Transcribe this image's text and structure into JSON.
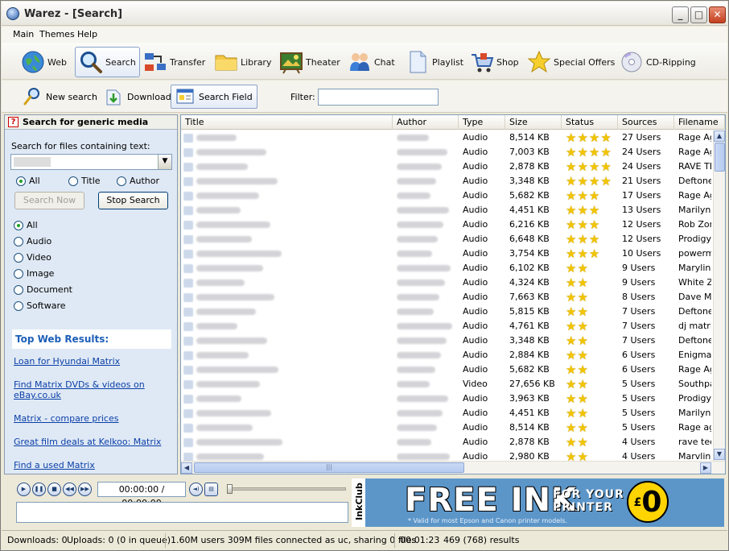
{
  "window": {
    "title": "Warez - [Search]"
  },
  "menu": [
    "Main",
    "Themes",
    "Help"
  ],
  "toolbar": [
    {
      "label": "Web",
      "icon": "globe-icon"
    },
    {
      "label": "Search",
      "icon": "magnifier-icon",
      "active": true
    },
    {
      "label": "Transfer",
      "icon": "transfer-icon"
    },
    {
      "label": "Library",
      "icon": "folder-icon"
    },
    {
      "label": "Theater",
      "icon": "theater-icon"
    },
    {
      "label": "Chat",
      "icon": "chat-people-icon"
    },
    {
      "label": "Playlist",
      "icon": "document-icon"
    },
    {
      "label": "Shop",
      "icon": "cart-icon"
    },
    {
      "label": "Special Offers",
      "icon": "star-icon"
    },
    {
      "label": "CD-Ripping",
      "icon": "cd-icon"
    }
  ],
  "toolbar2": {
    "new_search": "New search",
    "download": "Download",
    "search_field": "Search Field",
    "filter_label": "Filter:",
    "filter_value": ""
  },
  "left": {
    "header": "Search for generic media",
    "search_label": "Search for files containing text:",
    "scope": [
      "All",
      "Title",
      "Author"
    ],
    "search_now": "Search Now",
    "stop_search": "Stop Search",
    "types": [
      "All",
      "Audio",
      "Video",
      "Image",
      "Document",
      "Software"
    ],
    "top_web": "Top Web Results:",
    "links": [
      "Loan for Hyundai Matrix",
      "Find Matrix DVDs & videos on eBay.co.uk",
      "Matrix - compare prices",
      "Great film deals at Kelkoo: Matrix",
      "Find a used Matrix"
    ]
  },
  "table": {
    "columns": [
      "Title",
      "Author",
      "Type",
      "Size",
      "Status",
      "Sources",
      "Filename"
    ],
    "rows": [
      {
        "type": "Audio",
        "size": "8,514 KB",
        "stars": 4,
        "sources": "27 Users",
        "file": "Rage Ag"
      },
      {
        "type": "Audio",
        "size": "7,003 KB",
        "stars": 4,
        "sources": "24 Users",
        "file": "Rage Ag"
      },
      {
        "type": "Audio",
        "size": "2,878 KB",
        "stars": 4,
        "sources": "24 Users",
        "file": "RAVE TE"
      },
      {
        "type": "Audio",
        "size": "3,348 KB",
        "stars": 4,
        "sources": "21 Users",
        "file": "Deftone"
      },
      {
        "type": "Audio",
        "size": "5,682 KB",
        "stars": 3,
        "sources": "17 Users",
        "file": "Rage Ag"
      },
      {
        "type": "Audio",
        "size": "4,451 KB",
        "stars": 3,
        "sources": "13 Users",
        "file": "Marilyn M"
      },
      {
        "type": "Audio",
        "size": "6,216 KB",
        "stars": 3,
        "sources": "12 Users",
        "file": "Rob Zom"
      },
      {
        "type": "Audio",
        "size": "6,648 KB",
        "stars": 3,
        "sources": "12 Users",
        "file": "Prodigy -"
      },
      {
        "type": "Audio",
        "size": "3,754 KB",
        "stars": 3,
        "sources": "10 Users",
        "file": "powerma"
      },
      {
        "type": "Audio",
        "size": "6,102 KB",
        "stars": 2,
        "sources": "9 Users",
        "file": "Marylin M"
      },
      {
        "type": "Audio",
        "size": "4,324 KB",
        "stars": 2,
        "sources": "9 Users",
        "file": "White Zo"
      },
      {
        "type": "Audio",
        "size": "7,663 KB",
        "stars": 2,
        "sources": "8 Users",
        "file": "Dave Ma"
      },
      {
        "type": "Audio",
        "size": "5,815 KB",
        "stars": 2,
        "sources": "7 Users",
        "file": "Deftones"
      },
      {
        "type": "Audio",
        "size": "4,761 KB",
        "stars": 2,
        "sources": "7 Users",
        "file": "dj matrix"
      },
      {
        "type": "Audio",
        "size": "3,348 KB",
        "stars": 2,
        "sources": "7 Users",
        "file": "Deftones"
      },
      {
        "type": "Audio",
        "size": "2,884 KB",
        "stars": 2,
        "sources": "6 Users",
        "file": "Enigma -"
      },
      {
        "type": "Audio",
        "size": "5,682 KB",
        "stars": 2,
        "sources": "6 Users",
        "file": "Rage Ag"
      },
      {
        "type": "Video",
        "size": "27,656 KB",
        "stars": 2,
        "sources": "5 Users",
        "file": "Southpa"
      },
      {
        "type": "Audio",
        "size": "3,963 KB",
        "stars": 2,
        "sources": "5 Users",
        "file": "Prodigy -"
      },
      {
        "type": "Audio",
        "size": "4,451 KB",
        "stars": 2,
        "sources": "5 Users",
        "file": "Marilyn M"
      },
      {
        "type": "Audio",
        "size": "8,514 KB",
        "stars": 2,
        "sources": "5 Users",
        "file": "Rage ag"
      },
      {
        "type": "Audio",
        "size": "2,878 KB",
        "stars": 2,
        "sources": "4 Users",
        "file": "rave tec"
      },
      {
        "type": "Audio",
        "size": "2,980 KB",
        "stars": 2,
        "sources": "4 Users",
        "file": "Marvlin M"
      }
    ]
  },
  "player": {
    "time": "00:00:00 / 00:00:00"
  },
  "banner": {
    "brand": "InkClub",
    "headline": "FREE INK",
    "sub1": "FOR YOUR",
    "sub2": "PRINTER",
    "price": "0",
    "currency": "£",
    "footnote": "* Valid for most Epson and Canon printer models."
  },
  "status": {
    "downloads": "Downloads: 0",
    "uploads": "Uploads: 0 (0 in queue)",
    "network": "1.60M users  309M files connected as uc, sharing 0 files",
    "time": "00:01:23",
    "results": "469 (768) results"
  }
}
